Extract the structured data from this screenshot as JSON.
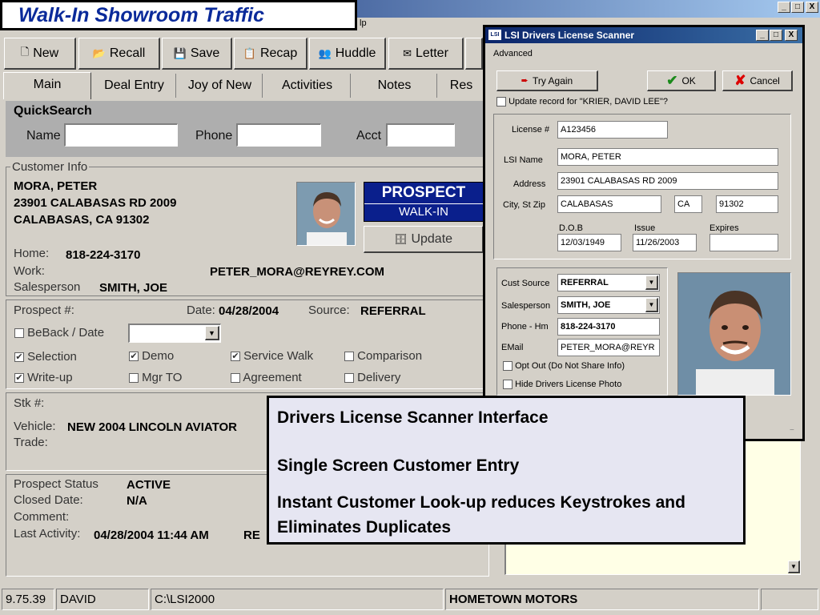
{
  "slide_title": "Walk-In Showroom Traffic",
  "menu_fragment": "lp",
  "window_controls": [
    "_",
    "□",
    "X"
  ],
  "toolbar": {
    "new": "New",
    "recall": "Recall",
    "save": "Save",
    "recap": "Recap",
    "huddle": "Huddle",
    "letter": "Letter"
  },
  "tabs": [
    "Main",
    "Deal Entry",
    "Joy of New",
    "Activities",
    "Notes",
    "Res"
  ],
  "quicksearch": {
    "title": "QuickSearch",
    "name": "Name",
    "phone": "Phone",
    "acct": "Acct"
  },
  "customer_info": {
    "legend": "Customer Info",
    "name": "MORA, PETER",
    "address1": "23901 CALABASAS RD 2009",
    "address2": "CALABASAS, CA  91302",
    "home_label": "Home:",
    "home": "818-224-3170",
    "work_label": "Work:",
    "email": "PETER_MORA@REYREY.COM",
    "salesperson_label": "Salesperson",
    "salesperson": "SMITH, JOE",
    "prospect": "PROSPECT",
    "walk_in": "WALK-IN",
    "update": "Update"
  },
  "prospect": {
    "number_label": "Prospect #:",
    "date_label": "Date:",
    "date": "04/28/2004",
    "source_label": "Source:",
    "source": "REFERRAL",
    "beback": "BeBack / Date",
    "checks": [
      {
        "label": "Selection",
        "checked": true
      },
      {
        "label": "Demo",
        "checked": true
      },
      {
        "label": "Service Walk",
        "checked": true
      },
      {
        "label": "Comparison",
        "checked": false
      },
      {
        "label": "Write-up",
        "checked": true
      },
      {
        "label": "Mgr TO",
        "checked": false
      },
      {
        "label": "Agreement",
        "checked": false
      },
      {
        "label": "Delivery",
        "checked": false
      }
    ]
  },
  "vehicle": {
    "stk_label": "Stk #:",
    "vehicle_label": "Vehicle:",
    "vehicle": "NEW 2004 LINCOLN AVIATOR",
    "trade_label": "Trade:"
  },
  "status_block": {
    "status_label": "Prospect Status",
    "status": "ACTIVE",
    "closed_label": "Closed Date:",
    "closed": "N/A",
    "comment_label": "Comment:",
    "last_label": "Last Activity:",
    "last": "04/28/2004 11:44 AM",
    "last_extra": "RE"
  },
  "dialog": {
    "title": "LSI Drivers License Scanner",
    "menu": "Advanced",
    "try_again": "Try Again",
    "ok": "OK",
    "cancel": "Cancel",
    "update_record": "Update record for \"KRIER, DAVID LEE\"?",
    "license_label": "License #",
    "license": "A123456",
    "lsi_name_label": "LSI Name",
    "lsi_name": "MORA, PETER",
    "address_label": "Address",
    "address": "23901 CALABASAS RD 2009",
    "city_label": "City, St Zip",
    "city": "CALABASAS",
    "state": "CA",
    "zip": "91302",
    "dob_label": "D.O.B",
    "dob": "12/03/1949",
    "issue_label": "Issue",
    "issue": "11/26/2003",
    "expires_label": "Expires",
    "expires": "",
    "cust_source_label": "Cust Source",
    "cust_source": "REFERRAL",
    "salesperson_label": "Salesperson",
    "salesperson": "SMITH, JOE",
    "phone_label": "Phone - Hm",
    "phone": "818-224-3170",
    "email_label": "EMail",
    "email": "PETER_MORA@REYR",
    "opt_out": "Opt Out (Do Not Share Info)",
    "hide_photo": "Hide Drivers License Photo"
  },
  "callout": {
    "line1": "Drivers License Scanner Interface",
    "line2": "Single Screen Customer Entry",
    "line3": "Instant Customer Look-up reduces Keystrokes and Eliminates Duplicates"
  },
  "statusbar": {
    "version": "9.75.39",
    "user": "DAVID",
    "path": "C:\\LSI2000",
    "dealer": "HOMETOWN MOTORS"
  },
  "colors": {
    "prospect_bg": "#0a1f8c",
    "title_text": "#0a2a9a",
    "note_bg": "#ffffe6"
  }
}
